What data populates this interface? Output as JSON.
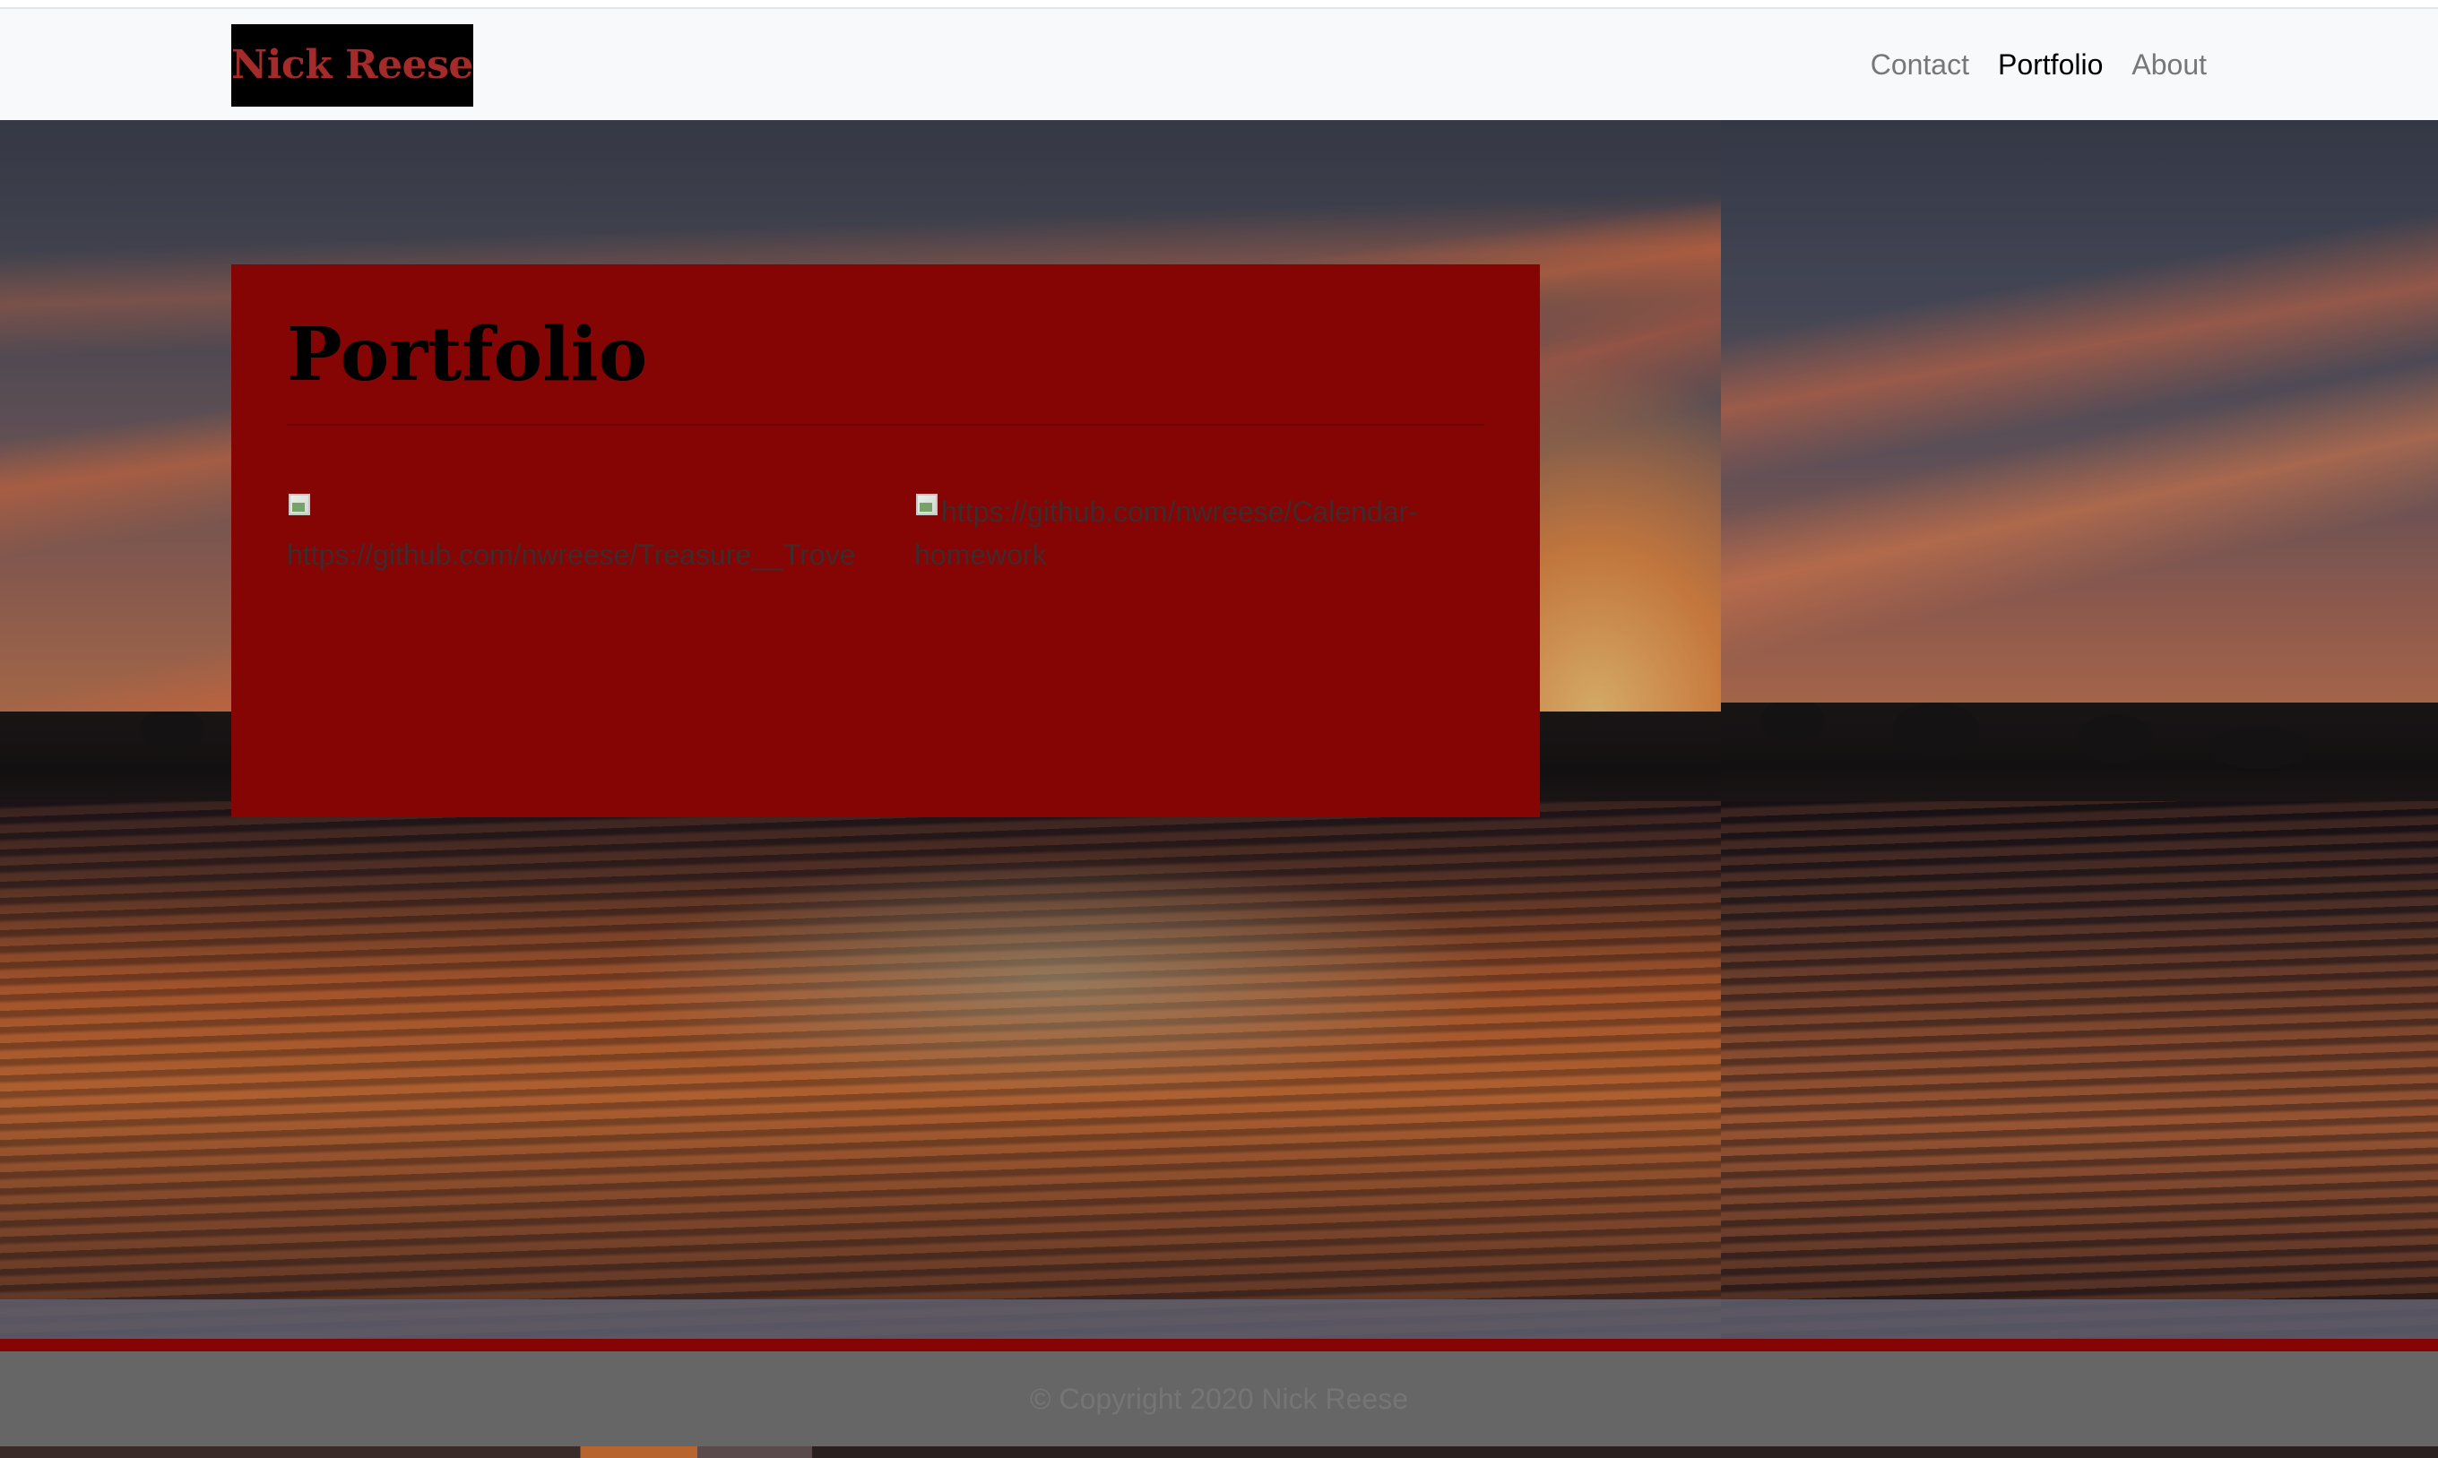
{
  "navbar": {
    "brand": "Nick Reese",
    "links": [
      {
        "label": "Contact",
        "active": false
      },
      {
        "label": "Portfolio",
        "active": true
      },
      {
        "label": "About",
        "active": false
      }
    ]
  },
  "main": {
    "title": "Portfolio",
    "projects": [
      {
        "alt": "https://github.com/nwreese/Treasure__Trove",
        "icon": "broken-image-icon"
      },
      {
        "alt": "https://github.com/nwreese/Calendar-homework",
        "icon": "broken-image-icon"
      }
    ]
  },
  "footer": {
    "copyright": "© Copyright 2020 Nick Reese"
  },
  "colors": {
    "panel": "#850404",
    "brand_text": "#a52a2a",
    "brand_bg": "#000000",
    "navbar_bg": "#f8f9fa",
    "footer_bg": "#666666"
  }
}
